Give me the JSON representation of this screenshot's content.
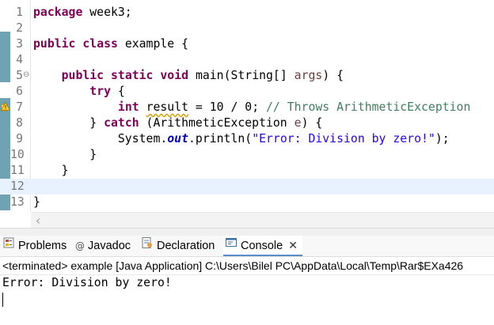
{
  "editor": {
    "lines": [
      {
        "n": "1",
        "parts": [
          {
            "t": "package",
            "c": "kw"
          },
          {
            "t": " week3;",
            "c": ""
          }
        ]
      },
      {
        "n": "2",
        "parts": []
      },
      {
        "n": "3",
        "parts": [
          {
            "t": "public",
            "c": "kw"
          },
          {
            "t": " ",
            "c": ""
          },
          {
            "t": "class",
            "c": "kw"
          },
          {
            "t": " example {",
            "c": ""
          }
        ]
      },
      {
        "n": "4",
        "parts": []
      },
      {
        "n": "5",
        "fold": true,
        "parts": [
          {
            "t": "    ",
            "c": ""
          },
          {
            "t": "public",
            "c": "kw"
          },
          {
            "t": " ",
            "c": ""
          },
          {
            "t": "static",
            "c": "kw"
          },
          {
            "t": " ",
            "c": ""
          },
          {
            "t": "void",
            "c": "kw"
          },
          {
            "t": " main(String[] ",
            "c": ""
          },
          {
            "t": "args",
            "c": "param"
          },
          {
            "t": ") {",
            "c": ""
          }
        ]
      },
      {
        "n": "6",
        "parts": [
          {
            "t": "        ",
            "c": ""
          },
          {
            "t": "try",
            "c": "kw"
          },
          {
            "t": " {",
            "c": ""
          }
        ]
      },
      {
        "n": "7",
        "warning": true,
        "parts": [
          {
            "t": "            ",
            "c": ""
          },
          {
            "t": "int",
            "c": "kw"
          },
          {
            "t": " ",
            "c": ""
          },
          {
            "t": "result",
            "c": "warnvar"
          },
          {
            "t": " = 10 / 0; ",
            "c": ""
          },
          {
            "t": "// Throws ArithmeticException",
            "c": "cmt"
          }
        ]
      },
      {
        "n": "8",
        "parts": [
          {
            "t": "        } ",
            "c": ""
          },
          {
            "t": "catch",
            "c": "kw"
          },
          {
            "t": " (ArithmeticException ",
            "c": ""
          },
          {
            "t": "e",
            "c": "param"
          },
          {
            "t": ") {",
            "c": ""
          }
        ]
      },
      {
        "n": "9",
        "parts": [
          {
            "t": "            System.",
            "c": ""
          },
          {
            "t": "out",
            "c": "fld"
          },
          {
            "t": ".println(",
            "c": ""
          },
          {
            "t": "\"Error: Division by zero!\"",
            "c": "str"
          },
          {
            "t": ");",
            "c": ""
          }
        ]
      },
      {
        "n": "10",
        "parts": [
          {
            "t": "        }",
            "c": ""
          }
        ]
      },
      {
        "n": "11",
        "parts": [
          {
            "t": "    }",
            "c": ""
          }
        ]
      },
      {
        "n": "12",
        "current": true,
        "parts": []
      },
      {
        "n": "13",
        "parts": [
          {
            "t": "}",
            "c": ""
          }
        ]
      }
    ]
  },
  "views": {
    "tabs": [
      {
        "id": "problems",
        "label": "Problems",
        "icon": "problems-icon"
      },
      {
        "id": "javadoc",
        "label": "Javadoc",
        "icon": "javadoc-icon"
      },
      {
        "id": "declaration",
        "label": "Declaration",
        "icon": "declaration-icon"
      },
      {
        "id": "console",
        "label": "Console",
        "icon": "console-icon",
        "active": true,
        "close": "✕"
      }
    ]
  },
  "console": {
    "status": "<terminated> example [Java Application] C:\\Users\\Bilel PC\\AppData\\Local\\Temp\\Rar$EXa426",
    "output": "Error: Division by zero!"
  },
  "colors": {
    "keyword": "#7f0055",
    "string": "#2a00ff",
    "comment": "#3f7f5f",
    "field": "#0000c0",
    "current_line": "#e8f2fe",
    "quick_diff": "#6fa3b3",
    "active_tab_underline": "#5b8ec9"
  }
}
